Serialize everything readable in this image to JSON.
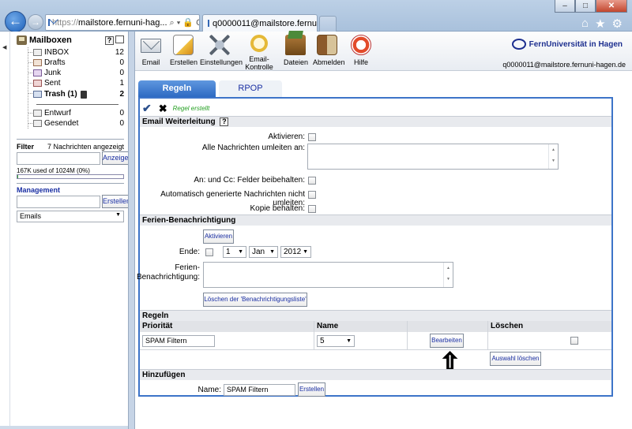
{
  "browser": {
    "address_scheme": "https://",
    "address_host": "mailstore.fernuni-hag...",
    "address_controls": "⌕ ▾ 🔒 C ✕",
    "tab_title": "q0000011@mailstore.fernu...",
    "tab_close": "×",
    "win_minimize": "–",
    "win_maximize": "□",
    "win_close": "✕",
    "home_icon": "⌂",
    "star_icon": "★",
    "gear_icon": "⚙"
  },
  "sidebar": {
    "mailboxes_title": "Mailboxen",
    "help": "?",
    "folders": [
      {
        "name": "INBOX",
        "count": "12",
        "icon": "inbox-icon",
        "bold": false
      },
      {
        "name": "Drafts",
        "count": "0",
        "icon": "drafts-icon",
        "bold": false
      },
      {
        "name": "Junk",
        "count": "0",
        "icon": "junk-icon",
        "bold": false
      },
      {
        "name": "Sent",
        "count": "1",
        "icon": "sent-icon",
        "bold": false
      },
      {
        "name": "Trash (1)",
        "count": "2",
        "icon": "trash-icon",
        "bold": true
      }
    ],
    "local_folders": [
      {
        "name": "Entwurf",
        "count": "0"
      },
      {
        "name": "Gesendet",
        "count": "0"
      }
    ],
    "filter_label": "Filter",
    "filter_info": "7 Nachrichten angezeigt",
    "filter_value": "",
    "filter_button": "Anzeigen",
    "quota_text": "167K used of 1024M  (0%)",
    "quota_fraction": 0.003,
    "management_label": "Management",
    "management_value": "",
    "create_button": "Erstellen",
    "emails_select": "Emails"
  },
  "toolbar": {
    "items": [
      {
        "label": "Email",
        "icon": "email-icon"
      },
      {
        "label": "Erstellen",
        "icon": "compose-icon"
      },
      {
        "label": "Einstellungen",
        "icon": "settings-icon"
      },
      {
        "label": "Email-Kontrolle",
        "icon": "search-icon"
      },
      {
        "label": "Dateien",
        "icon": "files-icon"
      },
      {
        "label": "Abmelden",
        "icon": "logout-icon"
      },
      {
        "label": "Hilfe",
        "icon": "help-icon"
      }
    ],
    "brand": "FernUniversität in Hagen",
    "user_email": "q0000011@mailstore.fernuni-hagen.de"
  },
  "tabs": [
    {
      "label": "Regeln",
      "active": true
    },
    {
      "label": "RPOP",
      "active": false
    }
  ],
  "status": {
    "check": "✔",
    "cancel": "✖",
    "message": "Regel erstellt"
  },
  "forwarding": {
    "title": "Email Weiterleitung",
    "help": "?",
    "activate_label": "Aktivieren:",
    "redirect_label": "Alle Nachrichten umleiten an:",
    "keep_to_cc_label": "An: und Cc: Felder beibehalten:",
    "no_auto_label": "Automatisch generierte Nachrichten nicht umleiten:",
    "keep_copy_label": "Kopie behalten:"
  },
  "vacation": {
    "title": "Ferien-Benachrichtigung",
    "activate_button": "Aktivieren",
    "end_label": "Ende:",
    "day": "1",
    "month": "Jan",
    "year": "2012",
    "message_label_1": "Ferien-",
    "message_label_2": "Benachrichtigung:",
    "clear_button": "Löschen der 'Benachrichtigungsliste'"
  },
  "rules": {
    "title": "Regeln",
    "col_priority": "Priorität",
    "col_name": "Name",
    "col_delete": "Löschen",
    "rows": [
      {
        "name": "SPAM Filtern",
        "priority": "5",
        "edit": "Bearbeiten"
      }
    ],
    "delete_selected_button": "Auswahl löschen"
  },
  "add": {
    "title": "Hinzufügen",
    "name_label": "Name:",
    "name_value": "SPAM Filtern",
    "create_button": "Erstellen"
  }
}
